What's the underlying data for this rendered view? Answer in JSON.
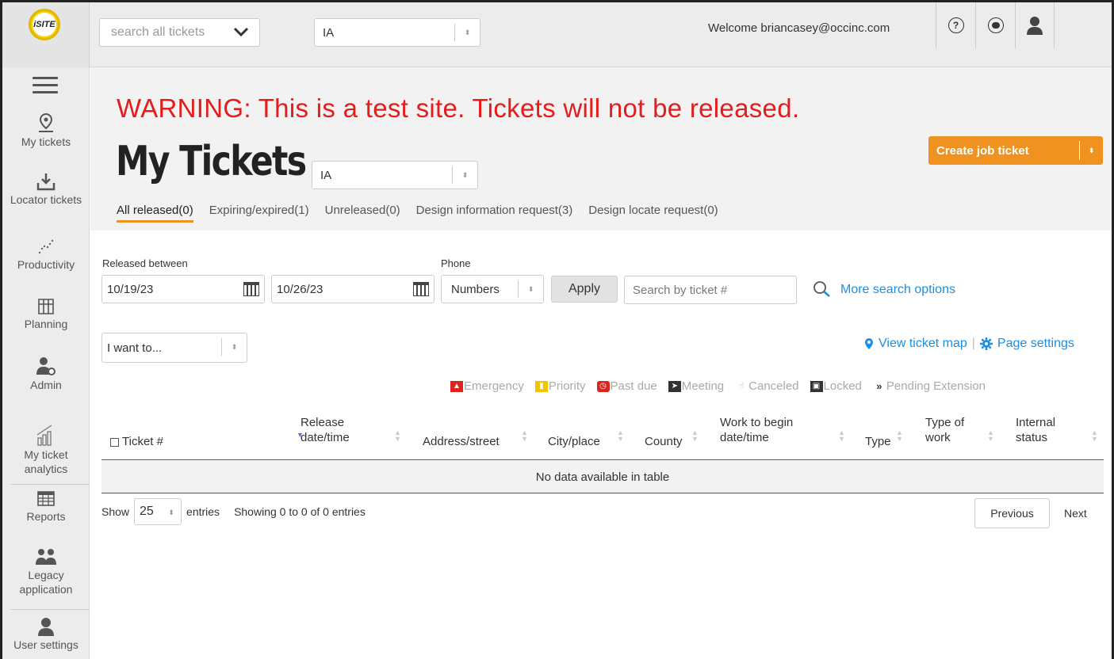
{
  "header": {
    "logo_text": "iSITE",
    "global_search_placeholder": "search all tickets",
    "state_value": "IA",
    "welcome_text": "Welcome briancasey@occinc.com"
  },
  "sidebar": {
    "items": [
      {
        "label": "My tickets",
        "icon": "map-pin-icon"
      },
      {
        "label": "Locator tickets",
        "icon": "download-tray-icon"
      },
      {
        "label": "Productivity",
        "icon": "dotted-trend-icon"
      },
      {
        "label": "Planning",
        "icon": "map-fold-icon"
      },
      {
        "label": "Admin",
        "icon": "user-gear-icon"
      },
      {
        "label": "My ticket analytics",
        "icon": "bar-chart-icon"
      },
      {
        "label": "Reports",
        "icon": "grid-table-icon"
      },
      {
        "label": "Legacy application",
        "icon": "users-icon"
      },
      {
        "label": "User settings",
        "icon": "user-icon"
      }
    ]
  },
  "page": {
    "warning": "WARNING: This is a test site. Tickets will not be released.",
    "title": "My Tickets",
    "state_value": "IA",
    "create_button": "Create job ticket",
    "tabs": [
      {
        "label": "All released(0)",
        "active": true
      },
      {
        "label": "Expiring/expired(1)",
        "active": false
      },
      {
        "label": "Unreleased(0)",
        "active": false
      },
      {
        "label": "Design information request(3)",
        "active": false
      },
      {
        "label": "Design locate request(0)",
        "active": false
      }
    ]
  },
  "filters": {
    "released_between_label": "Released between",
    "date_from": "10/19/23",
    "date_to": "10/26/23",
    "phone_label": "Phone",
    "phone_value": "Numbers",
    "apply_label": "Apply",
    "search_placeholder": "Search by ticket #",
    "more_search": "More search options",
    "i_want_to": "I want to...",
    "view_map": "View ticket map",
    "page_settings": "Page settings"
  },
  "legend": [
    {
      "label": "Emergency",
      "color": "#d9251c",
      "icon": "warning-triangle-icon"
    },
    {
      "label": "Priority",
      "color": "#f2c500",
      "icon": "flag-icon"
    },
    {
      "label": "Past due",
      "color": "#d9251c",
      "icon": "clock-icon"
    },
    {
      "label": "Meeting",
      "color": "#333333",
      "icon": "arrow-icon"
    },
    {
      "label": "Canceled",
      "color": "#aaaaaa",
      "icon": "hand-icon"
    },
    {
      "label": "Locked",
      "color": "#333333",
      "icon": "lock-icon"
    },
    {
      "label": "Pending Extension",
      "color": "#333333",
      "icon": "double-chevron-icon"
    }
  ],
  "table": {
    "columns": [
      {
        "line1": "Ticket #",
        "line2": ""
      },
      {
        "line1": "Release",
        "line2": "date/time"
      },
      {
        "line1": "Address/street",
        "line2": ""
      },
      {
        "line1": "City/place",
        "line2": ""
      },
      {
        "line1": "County",
        "line2": ""
      },
      {
        "line1": "Work to begin",
        "line2": "date/time"
      },
      {
        "line1": "Type",
        "line2": ""
      },
      {
        "line1": "Type of",
        "line2": "work"
      },
      {
        "line1": "Internal",
        "line2": "status"
      }
    ],
    "empty_text": "No data available in table",
    "show_label": "Show",
    "entries_value": "25",
    "entries_label": "entries",
    "showing_text": "Showing 0 to 0 of 0 entries",
    "previous": "Previous",
    "next": "Next"
  },
  "colors": {
    "accent": "#ef921f",
    "warning": "#e41c1c",
    "link": "#1a8fe0"
  }
}
